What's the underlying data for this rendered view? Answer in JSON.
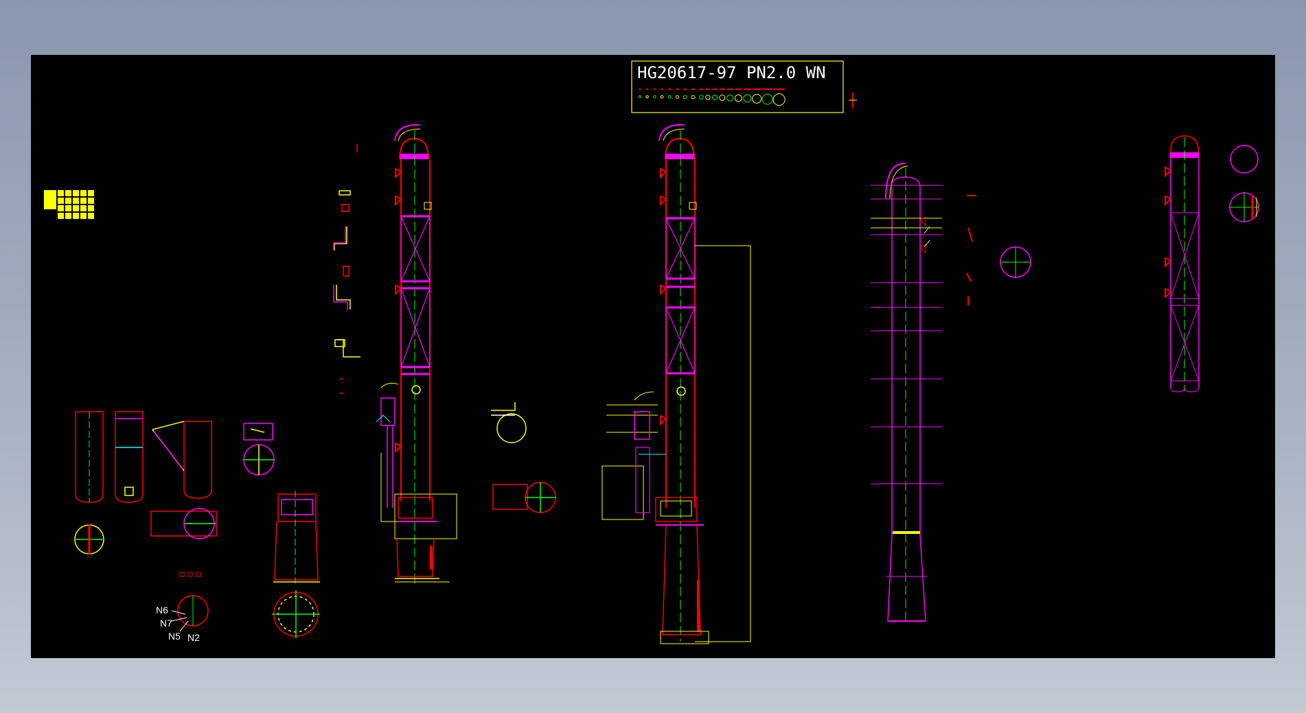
{
  "title_block": {
    "standard_label": "HG20617-97 PN2.0 WN"
  },
  "nozzle_labels": [
    "N6",
    "N7",
    "N5",
    "N2"
  ],
  "colors": {
    "canvas": "#000000",
    "magenta": "#ff00ff",
    "red": "#ff0000",
    "yellow": "#ffff00",
    "green": "#00ff00",
    "cyan": "#00ffff",
    "white": "#ffffff"
  }
}
